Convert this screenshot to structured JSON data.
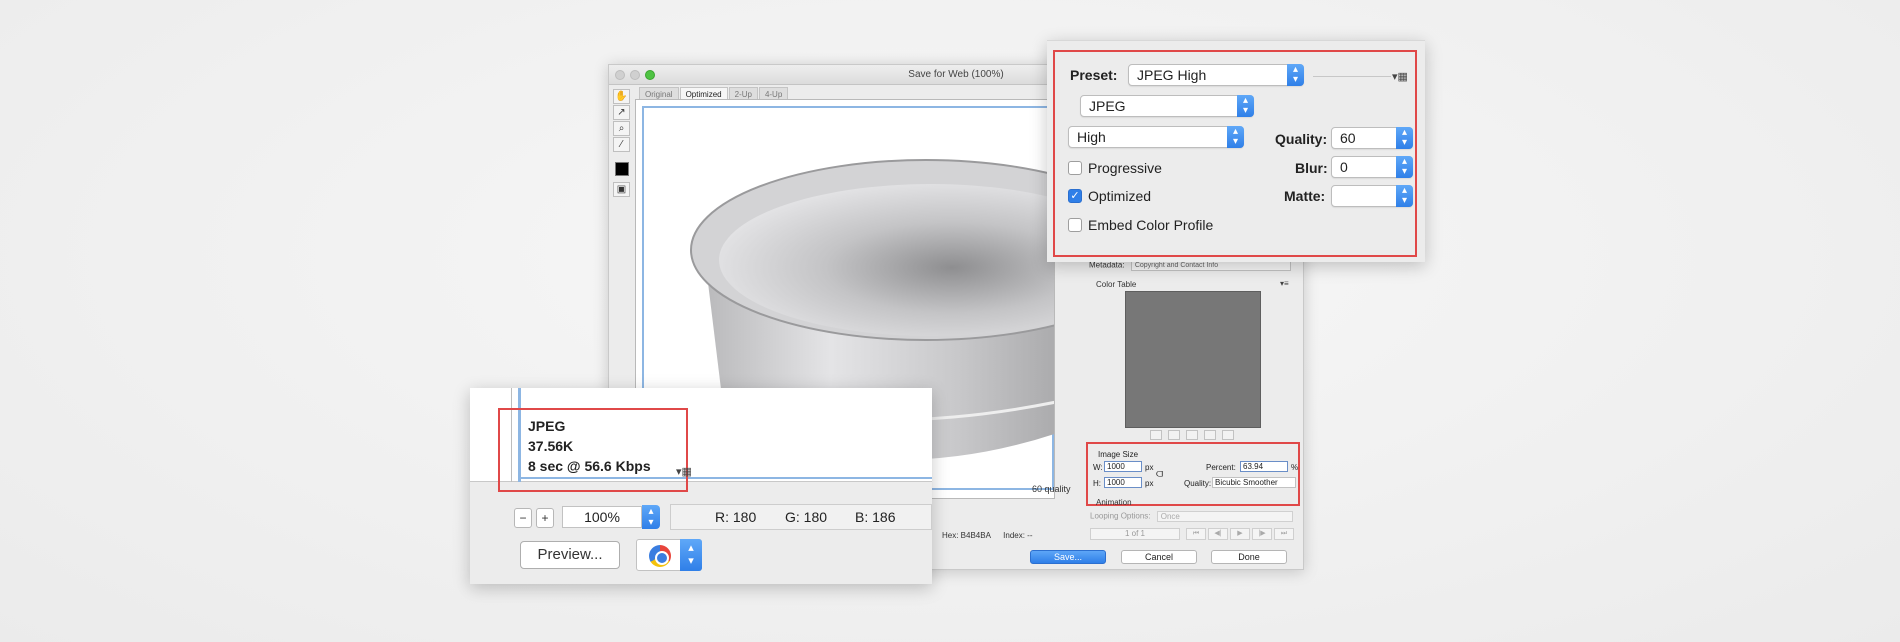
{
  "window": {
    "title": "Save for Web (100%)",
    "tabs": [
      "Original",
      "Optimized",
      "2-Up",
      "4-Up"
    ],
    "active_tab": "Optimized",
    "quality_label": "60 quality",
    "metadata_label": "Metadata:",
    "metadata_value": "Copyright and Contact Info",
    "color_table_label": "Color Table",
    "menu_glyph": "▾≡",
    "image_size": {
      "title": "Image Size",
      "w_label": "W:",
      "w_value": "1000",
      "h_label": "H:",
      "h_value": "1000",
      "unit": "px",
      "percent_label": "Percent:",
      "percent_value": "63.94",
      "percent_unit": "%",
      "quality_label": "Quality:",
      "quality_value": "Bicubic Smoother"
    },
    "animation_label": "Animation",
    "looping_label": "Looping Options:",
    "looping_value": "Once",
    "pager": "1 of 1",
    "hex": "Hex: B4B4BA",
    "index": "Index: --",
    "save_label": "Save...",
    "cancel_label": "Cancel",
    "done_label": "Done"
  },
  "settings": {
    "preset_label": "Preset:",
    "preset_value": "JPEG High",
    "format_value": "JPEG",
    "compression_value": "High",
    "quality_label": "Quality:",
    "quality_value": "60",
    "blur_label": "Blur:",
    "blur_value": "0",
    "matte_label": "Matte:",
    "matte_value": "",
    "progressive_label": "Progressive",
    "progressive_checked": false,
    "optimized_label": "Optimized",
    "optimized_checked": true,
    "embed_label": "Embed Color Profile",
    "embed_checked": false
  },
  "info": {
    "format": "JPEG",
    "size": "37.56K",
    "download": "8 sec @ 56.6 Kbps",
    "zoom_value": "100%",
    "r": "R: 180",
    "g": "G: 180",
    "b": "B: 186",
    "preview_label": "Preview...",
    "menu_glyph": "▾▦"
  },
  "colors": {
    "highlight": "#e04848",
    "accent": "#2f7fe8",
    "selection": "#8db6e3"
  },
  "icons": [
    "hand-icon",
    "slice-select-icon",
    "zoom-icon",
    "eyedropper-icon",
    "checkmark-icon",
    "browser-globe-icon"
  ]
}
